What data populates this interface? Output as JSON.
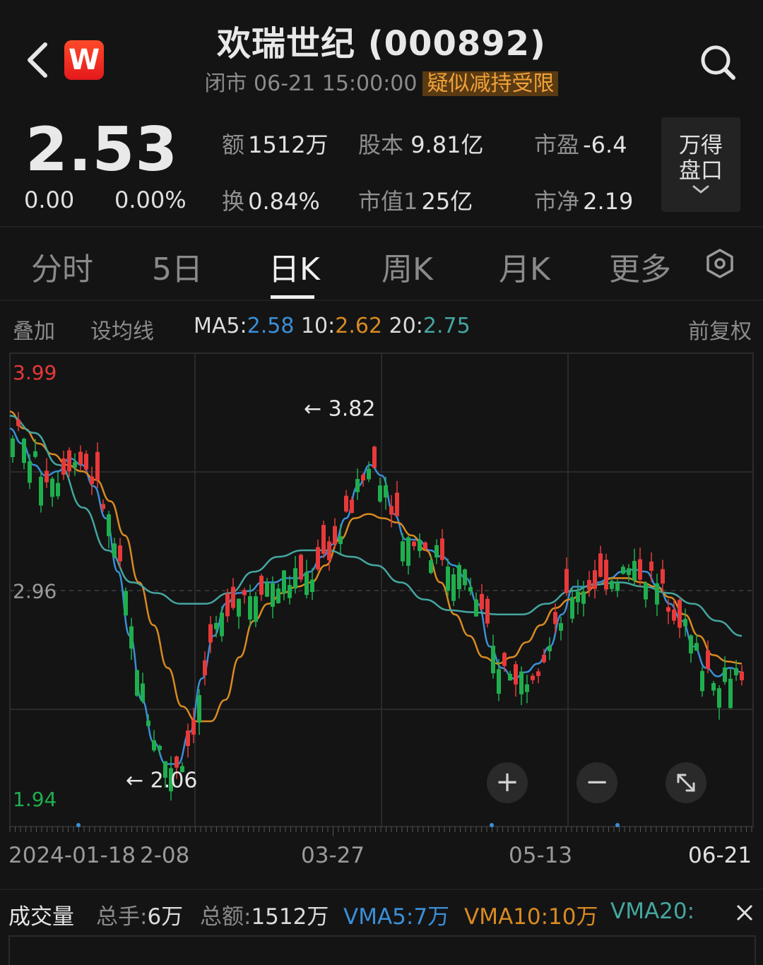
{
  "header": {
    "back_icon": "chevron-left-icon",
    "logo_letter": "W",
    "title": "欢瑞世纪 (000892)",
    "status": "闭市 06-21 15:00:00",
    "warning": "疑似减持受限",
    "search_icon": "search-icon"
  },
  "quote": {
    "price": "2.53",
    "change": "0.00",
    "change_pct": "0.00%",
    "stats": [
      {
        "label": "额",
        "value": "1512万"
      },
      {
        "label": "股本",
        "value": "9.81亿"
      },
      {
        "label": "市盈",
        "value": "-6.4"
      },
      {
        "label": "换",
        "value": "0.84%"
      },
      {
        "label": "市值1",
        "value": "25亿"
      },
      {
        "label": "市净",
        "value": "2.19"
      }
    ],
    "wind_button": [
      "万得",
      "盘口"
    ],
    "wind_chevron_icon": "chevron-down-icon"
  },
  "tabs": [
    "分时",
    "5日",
    "日K",
    "周K",
    "月K",
    "更多"
  ],
  "active_tab": "日K",
  "settings_icon": "settings-hexagon-icon",
  "ma_bar": {
    "overlay": "叠加",
    "set_ma": "设均线",
    "ma5_label": "MA5:",
    "ma5": "2.58",
    "ma10_label": "10:",
    "ma10": "2.62",
    "ma20_label": "20:",
    "ma20": "2.75",
    "adjust": "前复权"
  },
  "colors": {
    "up": "#e8393a",
    "down": "#1fae4e",
    "ma5": "#3a8fd8",
    "ma10": "#d98a22",
    "ma20": "#45a6a0",
    "background": "#141414"
  },
  "chart_data": {
    "type": "candlestick",
    "y_labels": [
      "3.99",
      "2.96",
      "1.94"
    ],
    "ylim": [
      1.94,
      3.99
    ],
    "x_labels": [
      "2024-01-18",
      "2-08",
      "03-27",
      "05-13",
      "06-21"
    ],
    "annotations": [
      {
        "text": "3.82",
        "value": 3.82
      },
      {
        "text": "2.06",
        "value": 2.06
      }
    ],
    "series": [
      {
        "name": "MA5",
        "values": [
          3.72,
          3.65,
          3.55,
          3.5,
          3.52,
          3.58,
          3.55,
          3.45,
          3.3,
          3.05,
          2.75,
          2.45,
          2.25,
          2.15,
          2.15,
          2.3,
          2.55,
          2.75,
          2.9,
          2.95,
          2.96,
          3.0,
          3.0,
          3.02,
          3.02,
          3.05,
          3.12,
          3.18,
          3.3,
          3.45,
          3.55,
          3.5,
          3.32,
          3.2,
          3.2,
          3.15,
          3.12,
          3.08,
          3.02,
          2.9,
          2.7,
          2.6,
          2.55,
          2.58,
          2.62,
          2.7,
          2.85,
          2.98,
          2.98,
          3.0,
          3.02,
          3.05,
          3.06,
          3.05,
          2.98,
          2.9,
          2.82,
          2.7,
          2.6,
          2.56,
          2.6,
          2.58
        ]
      },
      {
        "name": "MA10",
        "values": [
          3.8,
          3.72,
          3.65,
          3.6,
          3.55,
          3.52,
          3.48,
          3.38,
          3.22,
          3.0,
          2.8,
          2.6,
          2.42,
          2.35,
          2.35,
          2.45,
          2.65,
          2.82,
          2.9,
          2.95,
          2.98,
          3.0,
          3.08,
          3.2,
          3.3,
          3.32,
          3.3,
          3.28,
          3.22,
          3.15,
          3.0,
          2.85,
          2.75,
          2.65,
          2.62,
          2.65,
          2.72,
          2.8,
          2.88,
          2.92,
          2.95,
          2.99,
          3.02,
          3.02,
          3.0,
          2.98,
          2.93,
          2.85,
          2.75,
          2.66,
          2.63,
          2.62
        ]
      },
      {
        "name": "MA20",
        "values": [
          3.78,
          3.7,
          3.55,
          3.35,
          3.15,
          3.0,
          2.95,
          2.9,
          2.9,
          2.95,
          3.05,
          3.12,
          3.15,
          3.15,
          3.12,
          3.08,
          3.0,
          2.92,
          2.87,
          2.86,
          2.85,
          2.85,
          2.9,
          2.96,
          2.99,
          3.0,
          2.98,
          2.95,
          2.9,
          2.82,
          2.75
        ]
      }
    ],
    "grid": true
  },
  "zoom": {
    "plus_icon": "zoom-in-icon",
    "minus_icon": "zoom-out-icon",
    "expand_icon": "expand-icon"
  },
  "volume": {
    "title": "成交量",
    "total_hand_label": "总手:",
    "total_hand": "6万",
    "total_amount_label": "总额:",
    "total_amount": "1512万",
    "vma5": "VMA5:7万",
    "vma10": "VMA10:10万",
    "vma20": "VMA20:",
    "close_icon": "close-icon"
  }
}
